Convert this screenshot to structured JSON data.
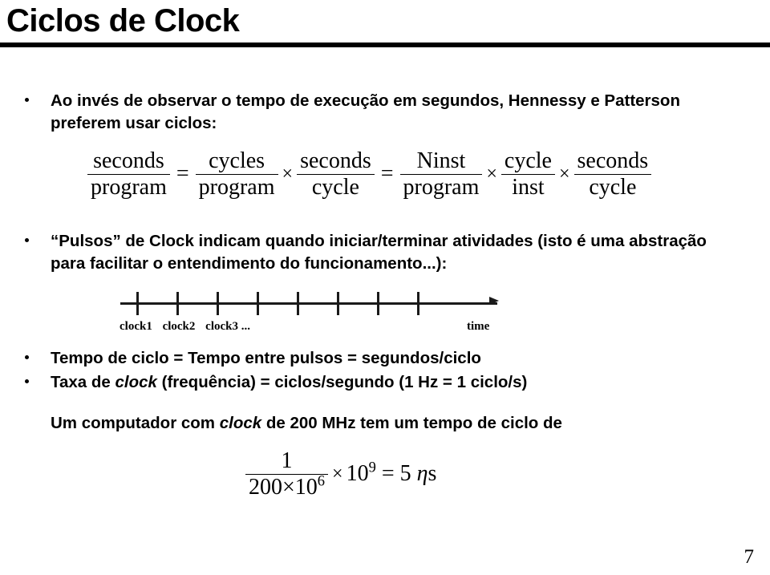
{
  "slide": {
    "title": "Ciclos de Clock",
    "page_number": "7"
  },
  "bullets": [
    {
      "text": "Ao invés de observar o tempo de execução em segundos, Hennessy e Patterson preferem usar ciclos:"
    },
    {
      "text": "“Pulsos” de Clock indicam quando iniciar/terminar atividades (isto é uma abstração para facilitar o entendimento do funcionamento...):"
    },
    {
      "text": "Tempo de ciclo = Tempo entre pulsos = segundos/ciclo"
    },
    {
      "prefix": "Taxa de ",
      "emphasis": "clock",
      "suffix": " (frequência) = ciclos/segundo  (1 Hz = 1 ciclo/s)"
    }
  ],
  "plain_line": {
    "prefix": "Um computador com ",
    "emphasis": "clock",
    "suffix": " de 200 MHz tem um tempo de ciclo de"
  },
  "equation_main": {
    "f1_num": "seconds",
    "f1_den": "program",
    "eq1": "=",
    "f2_num": "cycles",
    "f2_den": "program",
    "times1": "×",
    "f3_num": "seconds",
    "f3_den": "cycle",
    "eq2": "=",
    "f4_num": "Ninst",
    "f4_den": "program",
    "times2": "×",
    "f5_num": "cycle",
    "f5_den": "inst",
    "times3": "×",
    "f6_num": "seconds",
    "f6_den": "cycle"
  },
  "equation_final": {
    "num": "1",
    "den_base": "200×10",
    "den_exp": "6",
    "times": "×",
    "ten": "10",
    "ten_exp": "9",
    "equals": "=",
    "result": "5 ",
    "eta": "η",
    "unit": "s"
  },
  "figure": {
    "clock_labels": [
      "clock1",
      "clock2",
      "clock3 ..."
    ],
    "time_label": "time",
    "tick_positions": [
      30,
      80,
      130,
      180,
      230,
      280,
      330,
      380
    ],
    "axis_color": "#1a1a1a"
  }
}
